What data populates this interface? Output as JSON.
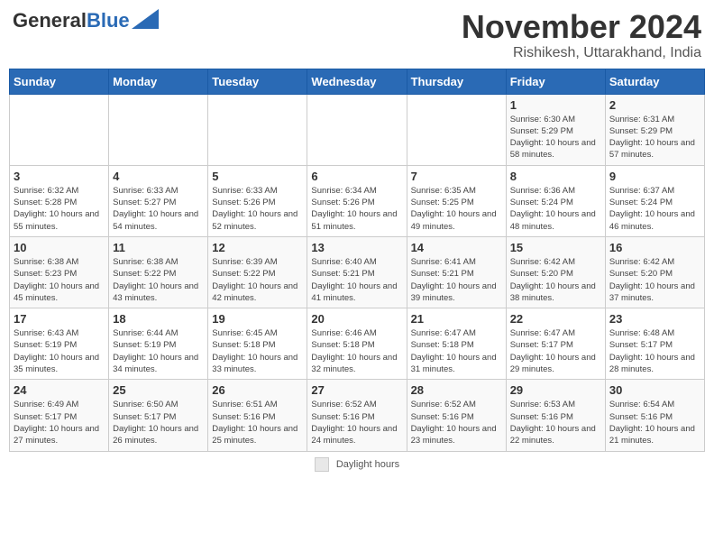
{
  "header": {
    "logo_general": "General",
    "logo_blue": "Blue",
    "month": "November 2024",
    "location": "Rishikesh, Uttarakhand, India"
  },
  "weekdays": [
    "Sunday",
    "Monday",
    "Tuesday",
    "Wednesday",
    "Thursday",
    "Friday",
    "Saturday"
  ],
  "footer": {
    "label": "Daylight hours"
  },
  "weeks": [
    [
      {
        "day": "",
        "info": ""
      },
      {
        "day": "",
        "info": ""
      },
      {
        "day": "",
        "info": ""
      },
      {
        "day": "",
        "info": ""
      },
      {
        "day": "",
        "info": ""
      },
      {
        "day": "1",
        "info": "Sunrise: 6:30 AM\nSunset: 5:29 PM\nDaylight: 10 hours and 58 minutes."
      },
      {
        "day": "2",
        "info": "Sunrise: 6:31 AM\nSunset: 5:29 PM\nDaylight: 10 hours and 57 minutes."
      }
    ],
    [
      {
        "day": "3",
        "info": "Sunrise: 6:32 AM\nSunset: 5:28 PM\nDaylight: 10 hours and 55 minutes."
      },
      {
        "day": "4",
        "info": "Sunrise: 6:33 AM\nSunset: 5:27 PM\nDaylight: 10 hours and 54 minutes."
      },
      {
        "day": "5",
        "info": "Sunrise: 6:33 AM\nSunset: 5:26 PM\nDaylight: 10 hours and 52 minutes."
      },
      {
        "day": "6",
        "info": "Sunrise: 6:34 AM\nSunset: 5:26 PM\nDaylight: 10 hours and 51 minutes."
      },
      {
        "day": "7",
        "info": "Sunrise: 6:35 AM\nSunset: 5:25 PM\nDaylight: 10 hours and 49 minutes."
      },
      {
        "day": "8",
        "info": "Sunrise: 6:36 AM\nSunset: 5:24 PM\nDaylight: 10 hours and 48 minutes."
      },
      {
        "day": "9",
        "info": "Sunrise: 6:37 AM\nSunset: 5:24 PM\nDaylight: 10 hours and 46 minutes."
      }
    ],
    [
      {
        "day": "10",
        "info": "Sunrise: 6:38 AM\nSunset: 5:23 PM\nDaylight: 10 hours and 45 minutes."
      },
      {
        "day": "11",
        "info": "Sunrise: 6:38 AM\nSunset: 5:22 PM\nDaylight: 10 hours and 43 minutes."
      },
      {
        "day": "12",
        "info": "Sunrise: 6:39 AM\nSunset: 5:22 PM\nDaylight: 10 hours and 42 minutes."
      },
      {
        "day": "13",
        "info": "Sunrise: 6:40 AM\nSunset: 5:21 PM\nDaylight: 10 hours and 41 minutes."
      },
      {
        "day": "14",
        "info": "Sunrise: 6:41 AM\nSunset: 5:21 PM\nDaylight: 10 hours and 39 minutes."
      },
      {
        "day": "15",
        "info": "Sunrise: 6:42 AM\nSunset: 5:20 PM\nDaylight: 10 hours and 38 minutes."
      },
      {
        "day": "16",
        "info": "Sunrise: 6:42 AM\nSunset: 5:20 PM\nDaylight: 10 hours and 37 minutes."
      }
    ],
    [
      {
        "day": "17",
        "info": "Sunrise: 6:43 AM\nSunset: 5:19 PM\nDaylight: 10 hours and 35 minutes."
      },
      {
        "day": "18",
        "info": "Sunrise: 6:44 AM\nSunset: 5:19 PM\nDaylight: 10 hours and 34 minutes."
      },
      {
        "day": "19",
        "info": "Sunrise: 6:45 AM\nSunset: 5:18 PM\nDaylight: 10 hours and 33 minutes."
      },
      {
        "day": "20",
        "info": "Sunrise: 6:46 AM\nSunset: 5:18 PM\nDaylight: 10 hours and 32 minutes."
      },
      {
        "day": "21",
        "info": "Sunrise: 6:47 AM\nSunset: 5:18 PM\nDaylight: 10 hours and 31 minutes."
      },
      {
        "day": "22",
        "info": "Sunrise: 6:47 AM\nSunset: 5:17 PM\nDaylight: 10 hours and 29 minutes."
      },
      {
        "day": "23",
        "info": "Sunrise: 6:48 AM\nSunset: 5:17 PM\nDaylight: 10 hours and 28 minutes."
      }
    ],
    [
      {
        "day": "24",
        "info": "Sunrise: 6:49 AM\nSunset: 5:17 PM\nDaylight: 10 hours and 27 minutes."
      },
      {
        "day": "25",
        "info": "Sunrise: 6:50 AM\nSunset: 5:17 PM\nDaylight: 10 hours and 26 minutes."
      },
      {
        "day": "26",
        "info": "Sunrise: 6:51 AM\nSunset: 5:16 PM\nDaylight: 10 hours and 25 minutes."
      },
      {
        "day": "27",
        "info": "Sunrise: 6:52 AM\nSunset: 5:16 PM\nDaylight: 10 hours and 24 minutes."
      },
      {
        "day": "28",
        "info": "Sunrise: 6:52 AM\nSunset: 5:16 PM\nDaylight: 10 hours and 23 minutes."
      },
      {
        "day": "29",
        "info": "Sunrise: 6:53 AM\nSunset: 5:16 PM\nDaylight: 10 hours and 22 minutes."
      },
      {
        "day": "30",
        "info": "Sunrise: 6:54 AM\nSunset: 5:16 PM\nDaylight: 10 hours and 21 minutes."
      }
    ]
  ]
}
